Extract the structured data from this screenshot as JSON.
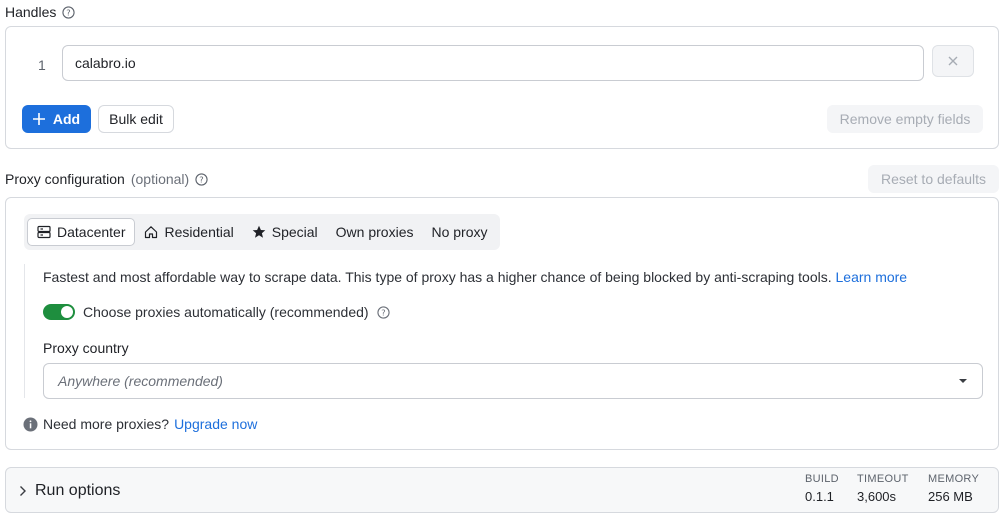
{
  "handles": {
    "title": "Handles",
    "items": [
      {
        "index": "1",
        "value": "calabro.io"
      }
    ],
    "add_label": "Add",
    "bulk_edit_label": "Bulk edit",
    "remove_empty_label": "Remove empty fields"
  },
  "proxy": {
    "title": "Proxy configuration",
    "optional": "(optional)",
    "reset_label": "Reset to defaults",
    "tabs": [
      {
        "label": "Datacenter",
        "icon": "server-icon",
        "active": true
      },
      {
        "label": "Residential",
        "icon": "home-icon",
        "active": false
      },
      {
        "label": "Special",
        "icon": "star-icon",
        "active": false
      },
      {
        "label": "Own proxies",
        "icon": "",
        "active": false
      },
      {
        "label": "No proxy",
        "icon": "",
        "active": false
      }
    ],
    "description": "Fastest and most affordable way to scrape data. This type of proxy has a higher chance of being blocked by anti-scraping tools.",
    "learn_more": "Learn more",
    "auto_label": "Choose proxies automatically (recommended)",
    "auto_enabled": true,
    "country_label": "Proxy country",
    "country_value": "Anywhere (recommended)",
    "need_more": "Need more proxies?",
    "upgrade": "Upgrade now"
  },
  "run_options": {
    "title": "Run options",
    "stats": [
      {
        "label": "BUILD",
        "value": "0.1.1"
      },
      {
        "label": "TIMEOUT",
        "value": "3,600s"
      },
      {
        "label": "MEMORY",
        "value": "256 MB"
      }
    ]
  },
  "colors": {
    "primary": "#1d6fdc",
    "toggle_on": "#1e8e3e",
    "border": "#d6d9de"
  }
}
